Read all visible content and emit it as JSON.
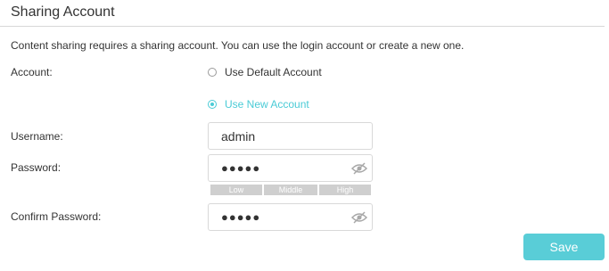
{
  "section": {
    "title": "Sharing Account",
    "description": "Content sharing requires a sharing account. You can use the login account or create a new one."
  },
  "account": {
    "label": "Account:",
    "options": [
      {
        "label": "Use Default Account",
        "checked": false
      },
      {
        "label": "Use New Account",
        "checked": true
      }
    ]
  },
  "username": {
    "label": "Username:",
    "value": "admin"
  },
  "password": {
    "label": "Password:",
    "value": "●●●●●",
    "icon": "eye-slash-icon",
    "strength": [
      "Low",
      "Middle",
      "High"
    ]
  },
  "confirm_password": {
    "label": "Confirm Password:",
    "value": "●●●●●",
    "icon": "eye-slash-icon"
  },
  "save_label": "Save",
  "colors": {
    "accent": "#4acbd6",
    "button": "#59cdd7",
    "strength_bar": "#cfcfcf"
  }
}
